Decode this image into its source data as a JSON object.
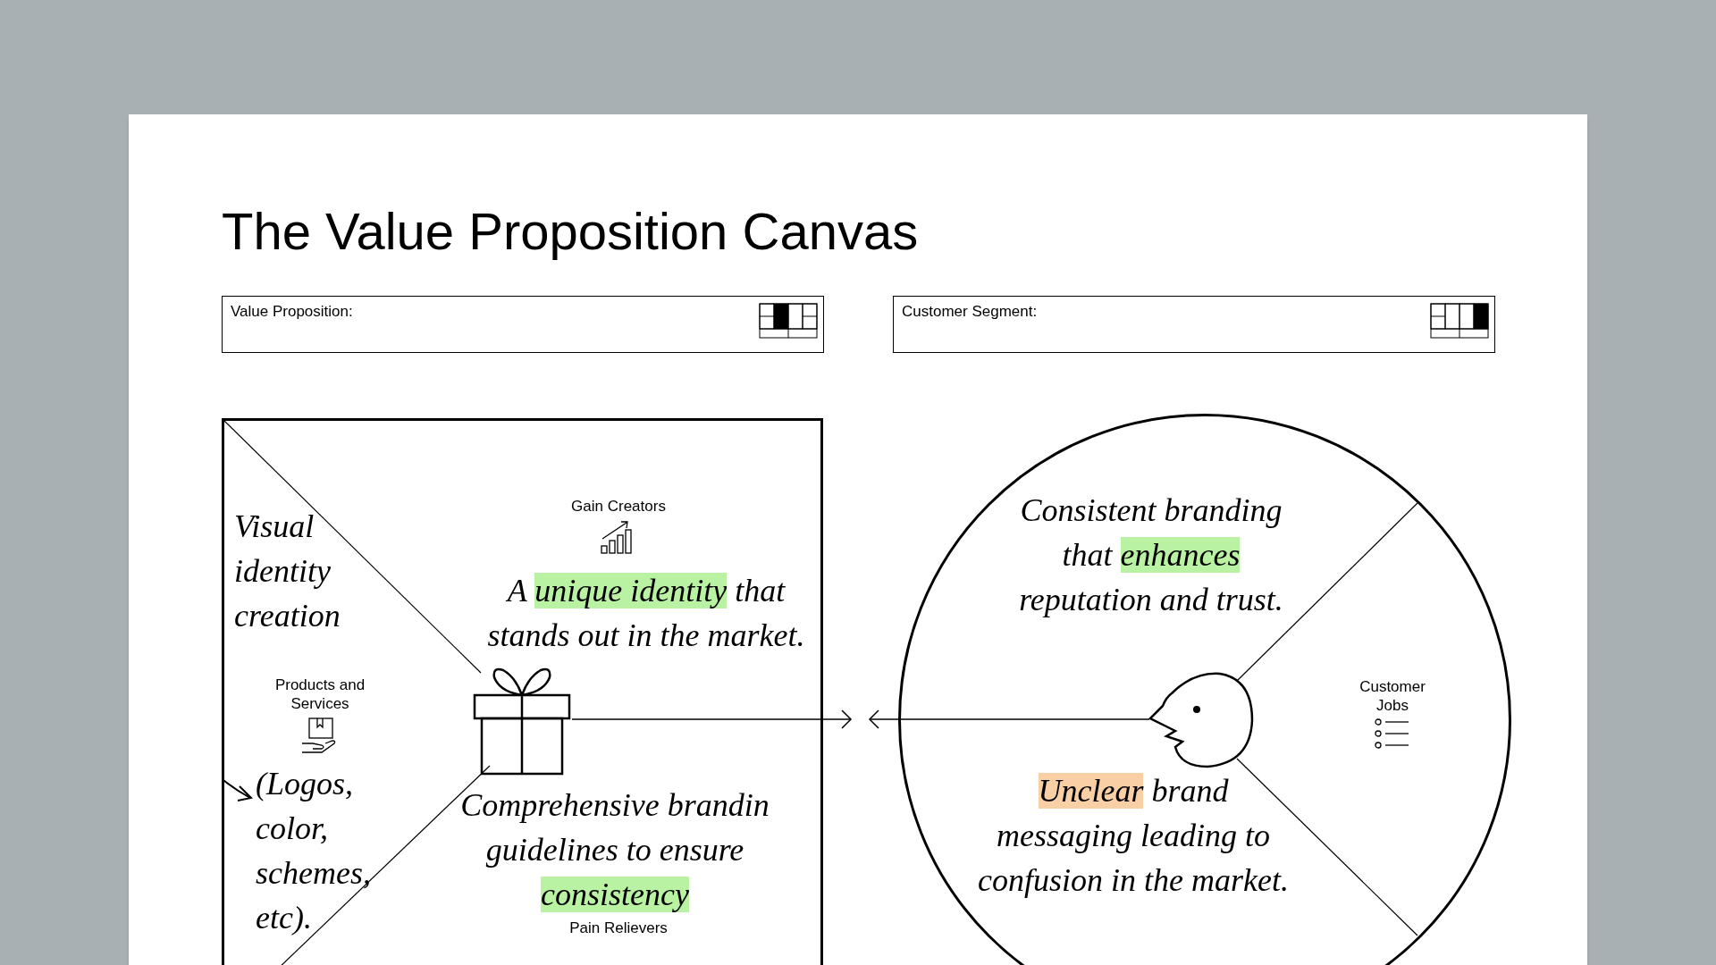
{
  "title": "The Value Proposition Canvas",
  "header_fields": [
    {
      "kind": "value-proposition",
      "label": "Value Proposition:"
    },
    {
      "kind": "customer-segment",
      "label": "Customer Segment:"
    }
  ],
  "value_map": {
    "sections": [
      {
        "kind": "gain-creators",
        "label": "Gain Creators"
      },
      {
        "kind": "products",
        "label": "Products and Services"
      },
      {
        "kind": "pain-relievers",
        "label": "Pain Relievers"
      }
    ]
  },
  "customer_profile": {
    "sections": [
      {
        "kind": "customer-jobs",
        "label": "Customer Jobs"
      }
    ]
  },
  "notes": [
    {
      "segments": [
        {
          "text": "Visual identity creation"
        }
      ]
    },
    {
      "segments": [
        {
          "text": "A "
        },
        {
          "text": "unique identity",
          "color": "#b9f2a3"
        },
        {
          "text": " that stands out in the market."
        }
      ]
    },
    {
      "segments": [
        {
          "text": "(Logos, color, schemes, etc)."
        }
      ]
    },
    {
      "segments": [
        {
          "text": "Comprehensive brandin guidelines to ensure "
        },
        {
          "text": "consistency",
          "color": "#b9f2a3"
        }
      ]
    },
    {
      "segments": [
        {
          "text": "Consistent branding that "
        },
        {
          "text": "enhances",
          "color": "#b9f2a3"
        },
        {
          "text": " reputation and trust."
        }
      ]
    },
    {
      "segments": [
        {
          "text": "Unclear",
          "color": "#f9cfa6"
        },
        {
          "text": " brand messaging leading to confusion in the market."
        }
      ]
    }
  ]
}
